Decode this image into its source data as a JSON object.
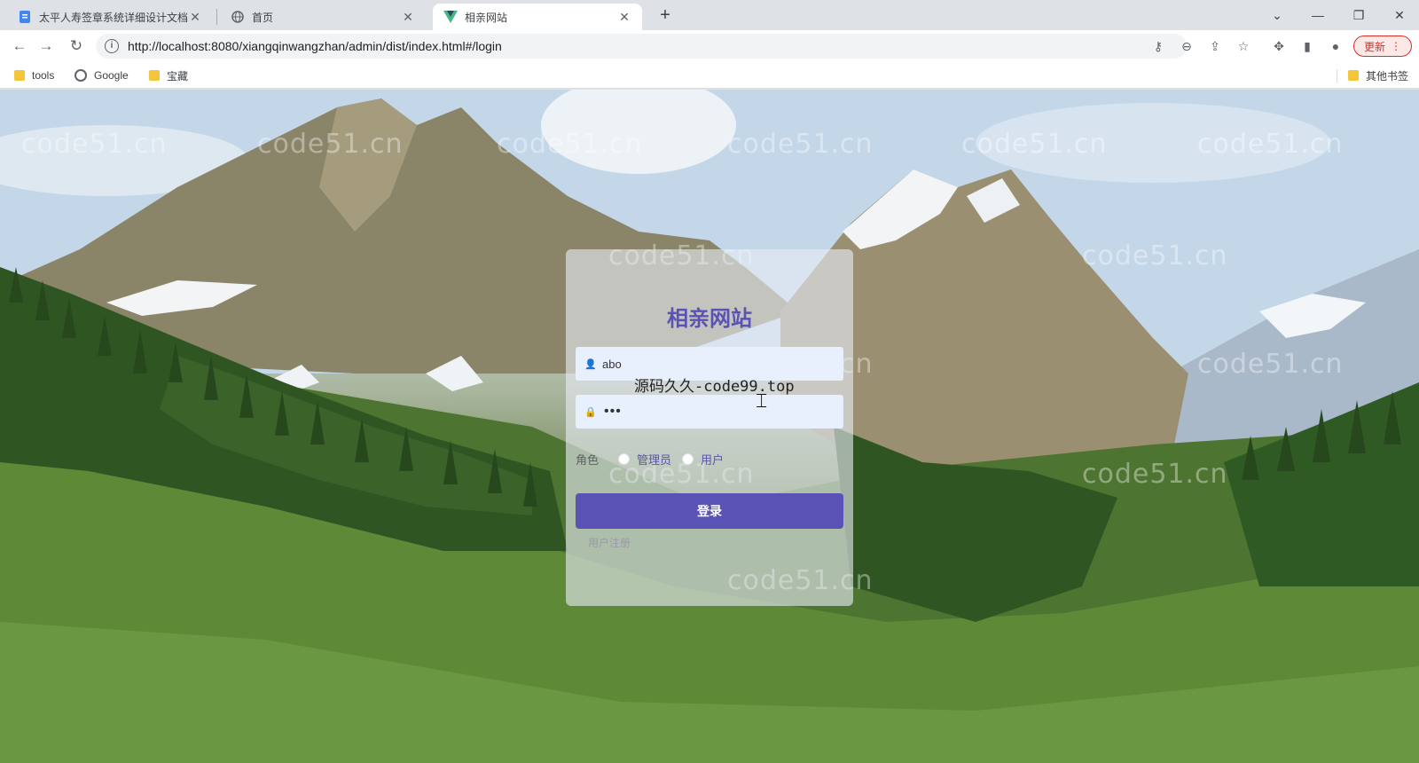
{
  "browser": {
    "tabs": [
      {
        "label": "太平人寿签章系统详细设计文档",
        "close": "✕"
      },
      {
        "label": "首页",
        "close": "✕"
      },
      {
        "label": "相亲网站",
        "close": "✕"
      }
    ],
    "new_tab": "+",
    "window_controls": {
      "dropdown": "⌄",
      "minimize": "—",
      "restore": "❐",
      "close": "✕"
    },
    "url": "http://localhost:8080/xiangqinwangzhan/admin/dist/index.html#/login",
    "update_label": "更新",
    "bookmarks": [
      {
        "label": "tools",
        "icon": "folder-icon"
      },
      {
        "label": "Google",
        "icon": "globe-icon"
      },
      {
        "label": "宝藏",
        "icon": "folder-icon"
      }
    ],
    "other_bookmarks": "其他书签"
  },
  "login": {
    "title": "相亲网站",
    "username_value": "abo",
    "password_mask": "•••",
    "role_label": "角色",
    "roles": [
      "管理员",
      "用户"
    ],
    "submit_label": "登录",
    "register_label": "用户注册"
  },
  "overlay_text": "源码久久-code99.top",
  "watermark": "code51.cn",
  "colors": {
    "accent": "#5a52b5",
    "field_bg": "#e8f0fe",
    "update_red": "#d93025"
  }
}
